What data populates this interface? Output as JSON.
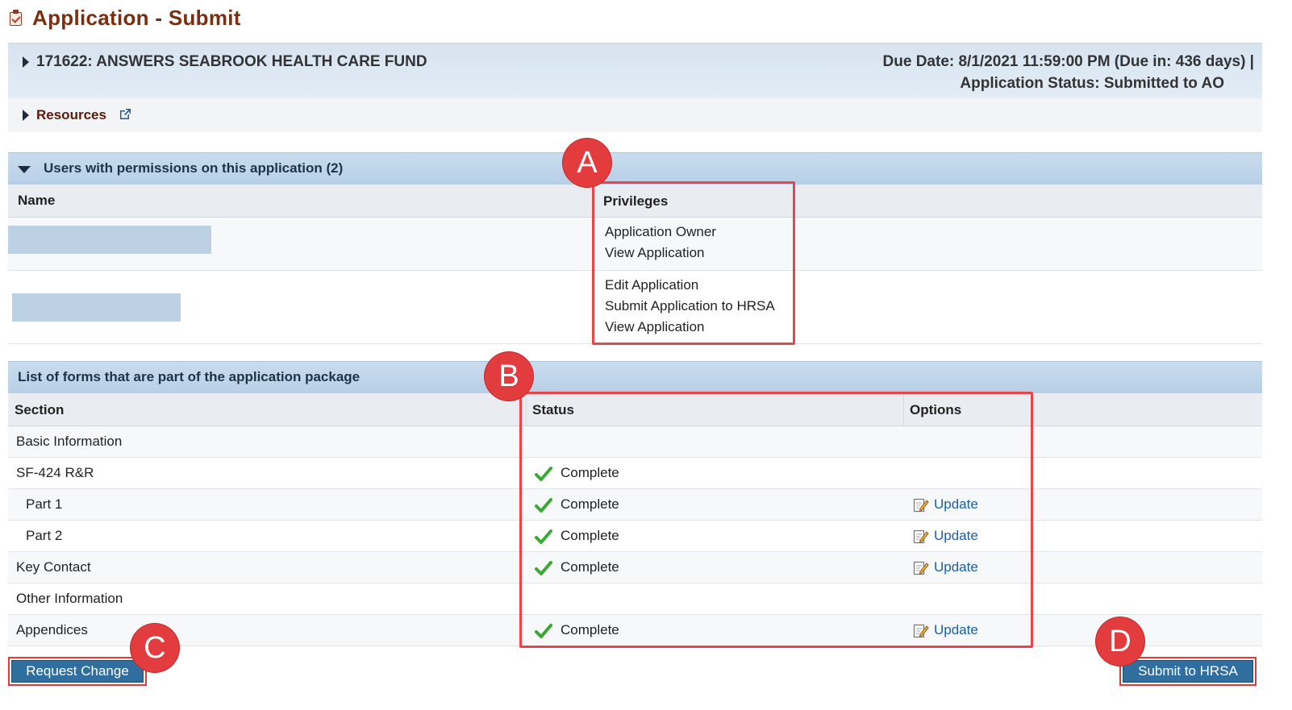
{
  "page": {
    "title": "Application - Submit",
    "title_icon": "clipboard-icon"
  },
  "header": {
    "application_title": "171622: ANSWERS SEABROOK HEALTH CARE FUND",
    "due_date": "Due Date: 8/1/2021 11:59:00 PM (Due in: 436 days) |",
    "status": "Application Status: Submitted to AO"
  },
  "resources": {
    "label": "Resources",
    "icon": "external-link-icon"
  },
  "users_section": {
    "title": "Users with permissions on this application (2)",
    "columns": {
      "name": "Name",
      "privileges": "Privileges"
    },
    "rows": [
      {
        "name_redacted": true,
        "privileges": [
          "Application Owner",
          "View Application"
        ]
      },
      {
        "name_redacted": true,
        "privileges": [
          "Edit Application",
          "Submit Application to HRSA",
          "View Application"
        ]
      }
    ]
  },
  "forms_section": {
    "title": "List of forms that are part of the application package",
    "columns": {
      "section": "Section",
      "status": "Status",
      "options": "Options"
    },
    "rows": [
      {
        "section": "Basic Information",
        "indent": false,
        "status": "",
        "option": ""
      },
      {
        "section": "SF-424 R&R",
        "indent": false,
        "status": "Complete",
        "option": ""
      },
      {
        "section": "Part 1",
        "indent": true,
        "status": "Complete",
        "option": "Update"
      },
      {
        "section": "Part 2",
        "indent": true,
        "status": "Complete",
        "option": "Update"
      },
      {
        "section": "Key Contact",
        "indent": false,
        "status": "Complete",
        "option": "Update"
      },
      {
        "section": "Other Information",
        "indent": false,
        "status": "",
        "option": ""
      },
      {
        "section": "Appendices",
        "indent": false,
        "status": "Complete",
        "option": "Update"
      }
    ]
  },
  "buttons": {
    "request_change": "Request Change",
    "submit": "Submit to HRSA"
  },
  "annotations": {
    "markers": [
      "A",
      "B",
      "C",
      "D"
    ],
    "highlight_color": "#e8464c"
  },
  "colors": {
    "title_brown": "#7a2f10",
    "section_blue": "#c9dcee",
    "button_blue": "#2f6e9e",
    "link_blue": "#1d5fa3",
    "check_green": "#3aa832"
  }
}
